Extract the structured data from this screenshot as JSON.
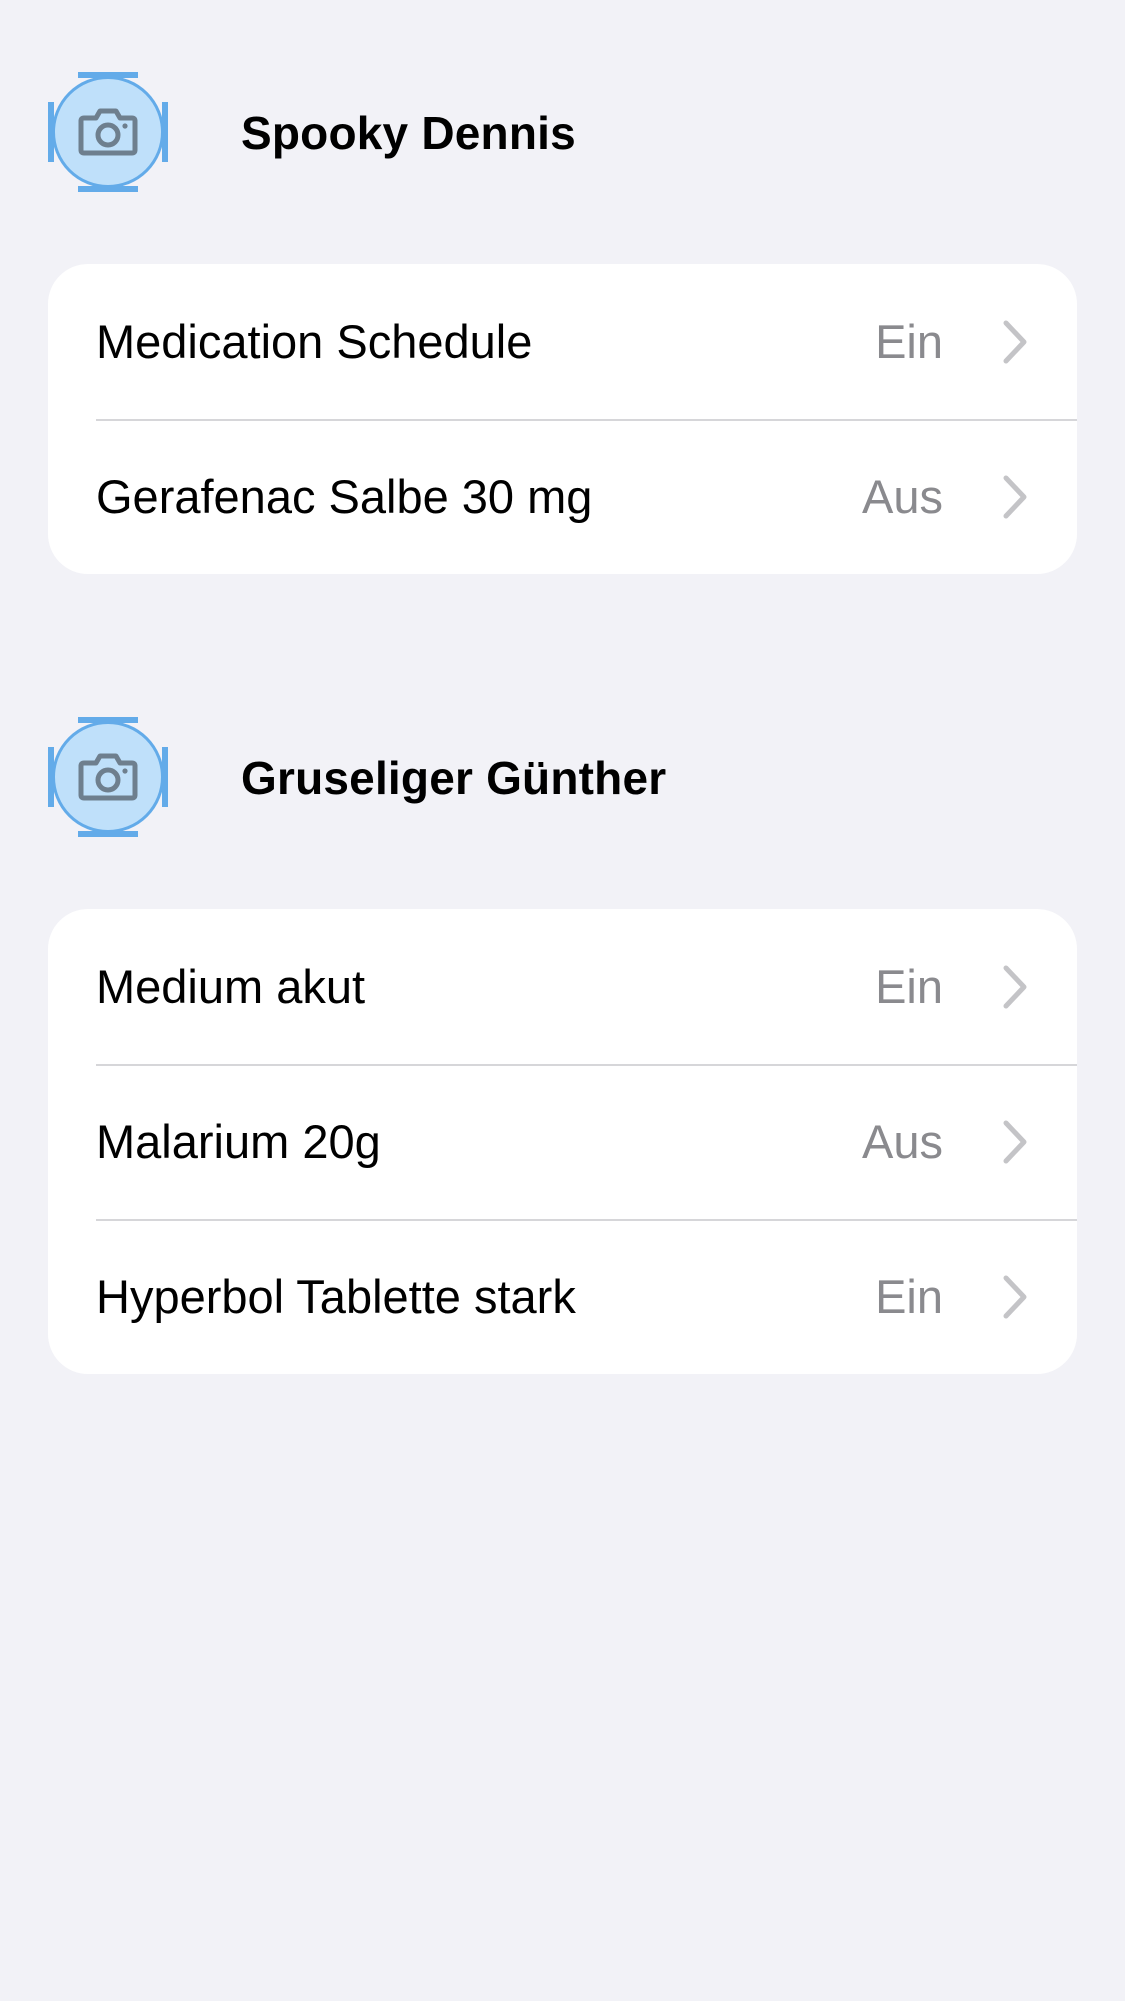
{
  "profiles": [
    {
      "name": "Spooky Dennis",
      "avatar_icon": "camera-icon",
      "items": [
        {
          "label": "Medication Schedule",
          "status": "Ein"
        },
        {
          "label": "Gerafenac Salbe 30 mg",
          "status": "Aus"
        }
      ]
    },
    {
      "name": "Gruseliger Günther",
      "avatar_icon": "camera-icon",
      "items": [
        {
          "label": "Medium akut",
          "status": "Ein"
        },
        {
          "label": "Malarium 20g",
          "status": "Aus"
        },
        {
          "label": "Hyperbol Tablette stark",
          "status": "Ein"
        }
      ]
    }
  ],
  "colors": {
    "background": "#f2f2f7",
    "card": "#ffffff",
    "avatar_fill": "#bfe0fa",
    "avatar_border": "#63abe9",
    "secondary_text": "#8a8a8e",
    "chevron": "#c4c4c7"
  }
}
